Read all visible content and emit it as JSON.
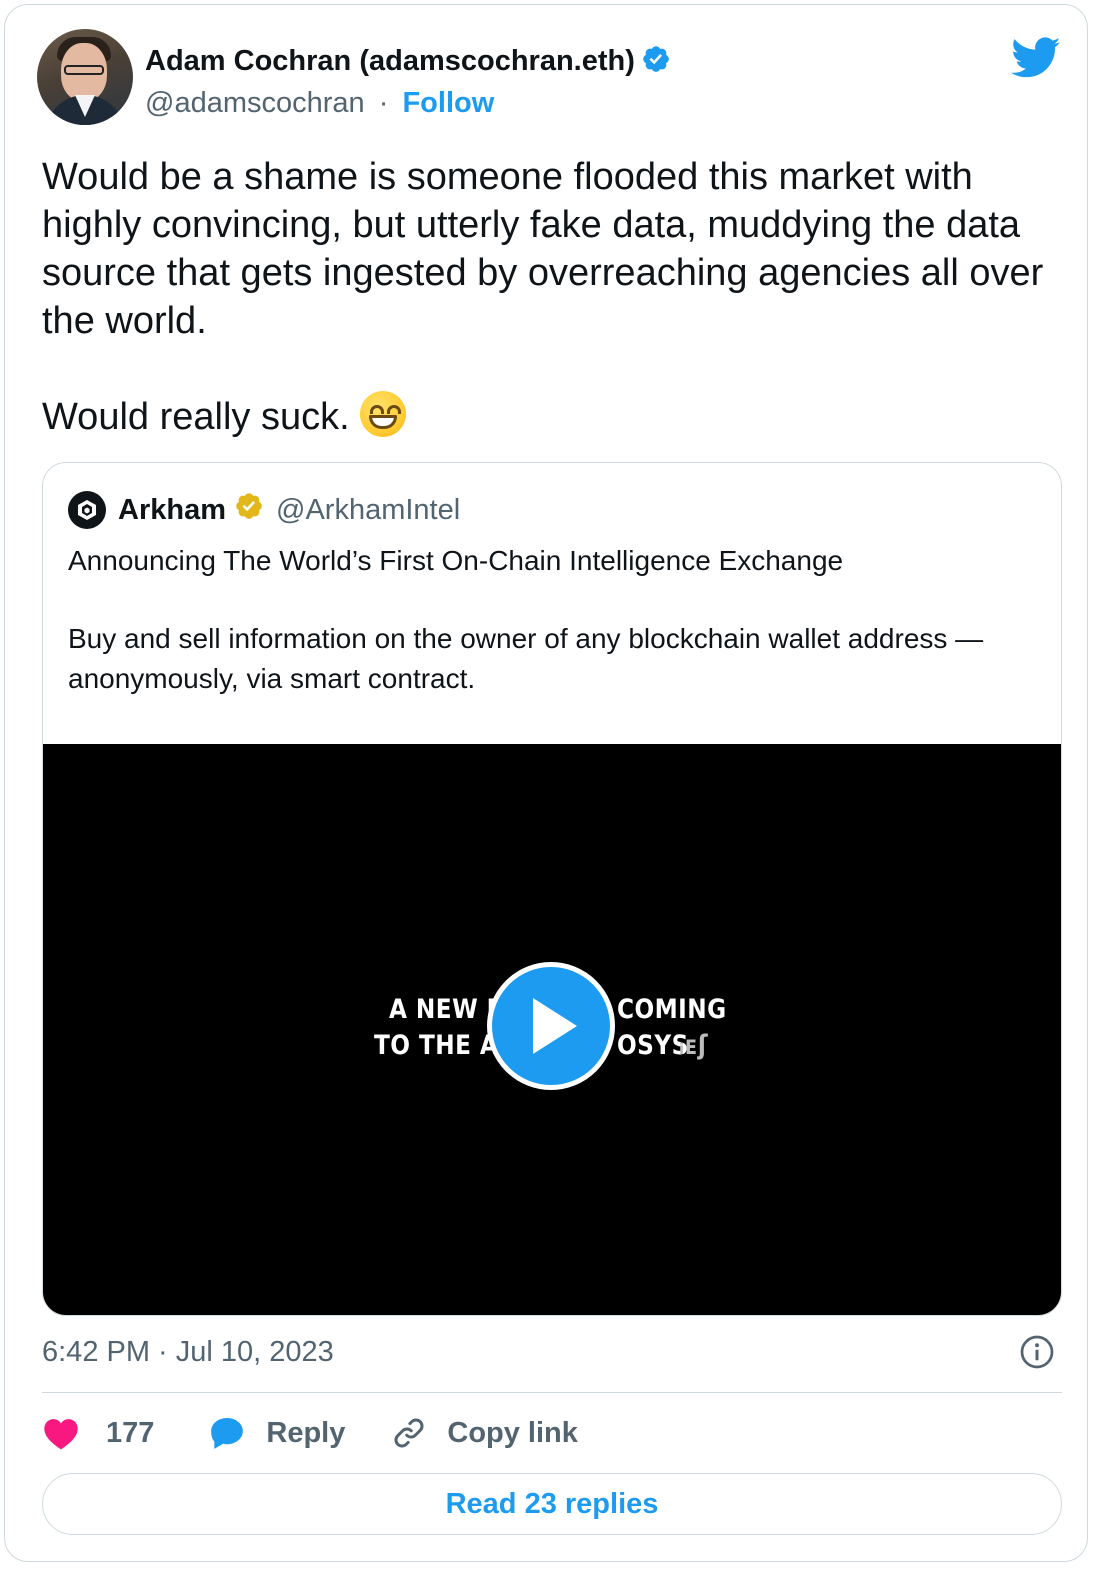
{
  "author": {
    "name": "Adam Cochran (adamscochran.eth)",
    "handle": "@adamscochran",
    "separator": "·",
    "follow_label": "Follow",
    "verified_badge": "blue-check-icon"
  },
  "tweet": {
    "text": "Would be a shame is someone flooded this market with highly convincing, but utterly fake data, muddying the data source that gets ingested by overreaching agencies all over the world.",
    "text2": "Would really suck.",
    "emoji": "grinning-face-with-smiling-eyes"
  },
  "quoted": {
    "name": "Arkham",
    "handle": "@ArkhamIntel",
    "verified_badge": "gold-check-icon",
    "line1": "Announcing The World’s First On-Chain Intelligence Exchange",
    "line2": "Buy and sell information on the owner of any blockchain wallet address —anonymously, via smart contract.",
    "video": {
      "overlay_line1_left": "A NEW P",
      "overlay_line1_right": "COMING",
      "overlay_line2_left": "TO THE A",
      "overlay_line2_right": "OSYS",
      "overlay_line2_tail": "ᵢᴇʃ"
    }
  },
  "meta": {
    "timestamp": "6:42 PM · Jul 10, 2023"
  },
  "actions": {
    "like_count": "177",
    "reply_label": "Reply",
    "copy_label": "Copy link"
  },
  "footer": {
    "read_replies_label": "Read 23 replies"
  },
  "colors": {
    "accent": "#1d9bf0",
    "text": "#0f1419",
    "secondary": "#536471",
    "border": "#cfd9de",
    "like": "#f91880",
    "gold": "#e2b719"
  }
}
